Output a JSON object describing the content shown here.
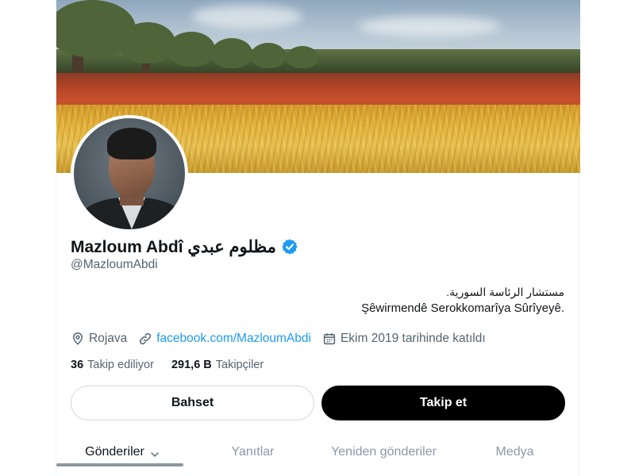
{
  "profile": {
    "display_name": "Mazloum Abdî مظلوم عبدي",
    "handle": "@MazloumAbdi",
    "verified": true,
    "bio": {
      "line1": "مستشار الرئاسة السورية.",
      "line2": "Şêwirmendê Serokkomarîya Sûrîyeyê."
    },
    "location": "Rojava",
    "website": "facebook.com/MazloumAbdi",
    "joined": "Ekim 2019 tarihinde katıldı",
    "following_count": "36",
    "following_label": "Takip ediliyor",
    "followers_count": "291,6 B",
    "followers_label": "Takipçiler"
  },
  "buttons": {
    "mention_label": "Bahset",
    "follow_label": "Takip et"
  },
  "tabs": [
    {
      "label": "Gönderiler",
      "active": true
    },
    {
      "label": "Yanıtlar",
      "active": false
    },
    {
      "label": "Yeniden gönderiler",
      "active": false
    },
    {
      "label": "Medya",
      "active": false
    }
  ],
  "icons": {
    "verified": "verified-badge-icon",
    "location": "location-pin-icon",
    "link": "link-icon",
    "calendar": "calendar-icon",
    "dropdown": "chevron-down-icon"
  },
  "colors": {
    "accent": "#1d9bf0",
    "text": "#0f1419",
    "secondary": "#536471",
    "follow_button": "#000000"
  }
}
